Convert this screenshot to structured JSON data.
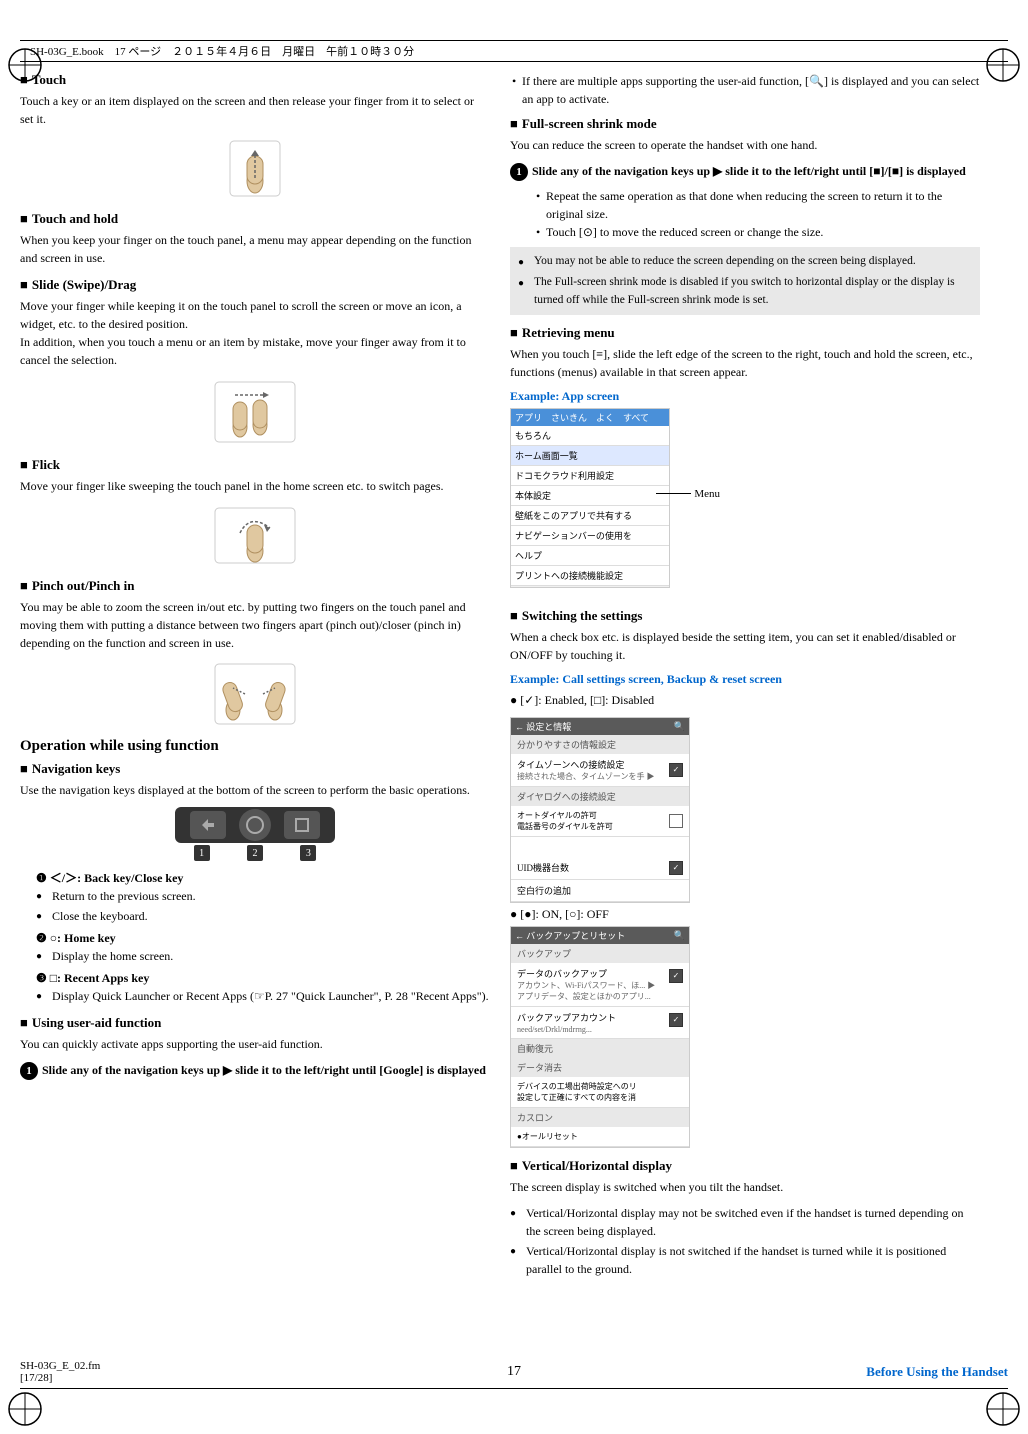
{
  "header": {
    "left": "SH-03G_E.book　17 ページ　２０１５年４月６日　月曜日　午前１０時３０分"
  },
  "left_column": {
    "touch": {
      "heading": "Touch",
      "body": "Touch a key or an item displayed on the screen and then release your finger from it to select or set it."
    },
    "touch_hold": {
      "heading": "Touch and hold",
      "body": "When you keep your finger on the touch panel, a menu may appear depending on the function and screen in use."
    },
    "slide": {
      "heading": "Slide (Swipe)/Drag",
      "body": "Move your finger while keeping it on the touch panel to scroll the screen or move an icon, a widget, etc. to the desired position.\nIn addition, when you touch a menu or an item by mistake, move your finger away from it to cancel the selection."
    },
    "flick": {
      "heading": "Flick",
      "body": "Move your finger like sweeping the touch panel in the home screen etc. to switch pages."
    },
    "pinch": {
      "heading": "Pinch out/Pinch in",
      "body": "You may be able to zoom the screen in/out etc. by putting two fingers on the touch panel and moving them with putting a distance between two fingers apart (pinch out)/closer (pinch in) depending on the function and screen in use."
    },
    "operation_heading": "Operation while using function",
    "nav_keys": {
      "heading": "Navigation keys",
      "body": "Use the navigation keys displayed at the bottom of the screen to perform the basic operations.",
      "key1_label": "❶ ＜/＞: Back key/Close key",
      "key1_b1": "Return to the previous screen.",
      "key1_b2": "Close the keyboard.",
      "key2_label": "❷ ○: Home key",
      "key2_b1": "Display the home screen.",
      "key3_label": "❸ □: Recent Apps key",
      "key3_b1": "Display Quick Launcher or Recent Apps (☞P. 27 \"Quick Launcher\", P. 28 \"Recent Apps\")."
    },
    "user_aid": {
      "heading": "Using user-aid function",
      "body": "You can quickly activate apps supporting the user-aid function.",
      "step1": "Slide any of the navigation keys up ▶ slide it to the left/right until [Google] is displayed"
    }
  },
  "right_column": {
    "user_aid_bullets": {
      "b1": "If there are multiple apps supporting the user-aid function, [🔍] is displayed and you can select an app to activate."
    },
    "full_screen": {
      "heading": "Full-screen shrink mode",
      "body": "You can reduce the screen to operate the handset with one hand.",
      "step1": "Slide any of the navigation keys up ▶ slide it to the left/right until [■]/[■] is displayed",
      "step1_b1": "Repeat the same operation as that done when reducing the screen to return it to the original size.",
      "step1_b2": "Touch [⊙] to move the reduced screen or change the size.",
      "note1": "You may not be able to reduce the screen depending on the screen being displayed.",
      "note2": "The Full-screen shrink mode is disabled if you switch to horizontal display or the display is turned off while the Full-screen shrink mode is set."
    },
    "retrieving_menu": {
      "heading": "Retrieving menu",
      "body": "When you touch [≡], slide the left edge of the screen to the right, touch and hold the screen, etc., functions (menus) available in that screen appear.",
      "example_label": "Example: App screen",
      "menu_label": "Menu"
    },
    "switching_settings": {
      "heading": "Switching the settings",
      "body": "When a check box etc. is displayed beside the setting item, you can set it enabled/disabled or ON/OFF by touching it.",
      "example_label": "Example: Call settings screen, Backup & reset screen",
      "checkbox_note": "● [✓]: Enabled, [□]: Disabled",
      "on_off_note": "● [●]: ON, [○]: OFF"
    },
    "vertical_horizontal": {
      "heading": "Vertical/Horizontal display",
      "body": "The screen display is switched when you tilt the handset.",
      "b1": "Vertical/Horizontal display may not be switched even if the handset is turned depending on the screen being displayed.",
      "b2": "Vertical/Horizontal display is not switched if the handset is turned while it is positioned parallel to the ground."
    }
  },
  "footer": {
    "page_number": "17",
    "right_text": "Before Using the Handset",
    "file_info": "SH-03G_E_02.fm\n[17/28]"
  },
  "nav_button_labels": [
    "1",
    "2",
    "3"
  ]
}
